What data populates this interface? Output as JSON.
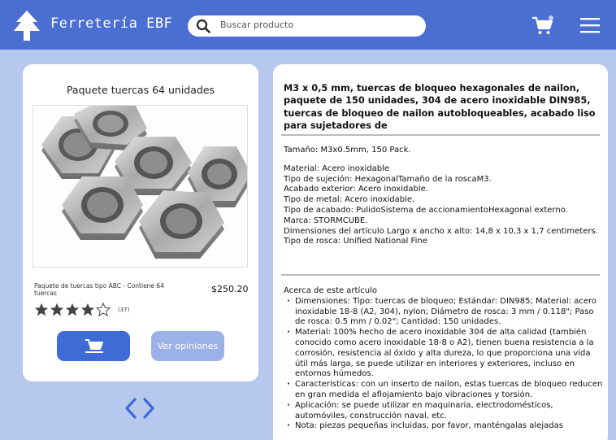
{
  "header": {
    "brand": "Ferretería EBF",
    "search_placeholder": "Buscar producto",
    "logo_icon": "pine-tree-icon",
    "cart_icon": "cart-icon",
    "menu_icon": "hamburger-menu-icon"
  },
  "product": {
    "title": "Paquete tuercas 64 unidades",
    "description": "Paquete de tuercas tipo ABC - Contiene 64 tuercas",
    "price": "$250.20",
    "rating": 4,
    "rating_max": 5,
    "reviews_count": "(37)",
    "add_to_cart_icon": "cart-icon",
    "reviews_button": "Ver opiniones"
  },
  "pager": {
    "icon": "chevron-left-right-icon"
  },
  "details": {
    "title": "M3 x 0,5 mm, tuercas de bloqueo hexagonales de nailon, paquete de 150 unidades, 304 de acero inoxidable DIN985, tuercas de bloqueo de nailon autobloqueables, acabado liso para sujetadores de",
    "size": "Tamaño: M3x0.5mm, 150 Pack.",
    "specs": [
      "Material: Acero inoxidable",
      "Tipo de sujeción: HexagonalTamaño de la roscaM3.",
      "Acabado exterior: Acero inoxidable.",
      "Tipo de metal: Acero inoxidable.",
      "Tipo de acabado: PulidoSistema de accionamientoHexagonal externo.",
      "Marca: STORMCUBE.",
      "Dimensiones del artículo Largo x ancho x alto: 14,8 x 10,3 x 1,7 centimeters.",
      "Tipo de rosca: Unified National Fine"
    ],
    "about_title": "Acerca de este artículo",
    "about_items": [
      "Dimensiones: Tipo: tuercas de bloqueo; Estándar: DIN985; Material: acero inoxidable 18-8 (A2, 304), nylon; Diámetro de rosca: 3 mm / 0.118\"; Paso de rosca: 0.5 mm / 0.02\"; Cantidad: 150 unidades.",
      "Material: 100% hecho de acero inoxidable 304 de alta calidad (también conocido como acero inoxidable 18-8 o A2), tienen buena resistencia a la corrosión, resistencia al óxido y alta dureza, lo que proporciona una vida útil más larga, se puede utilizar en interiores y exteriores, incluso en entornos húmedos.",
      "Características: con un inserto de nailon, estas tuercas de bloqueo reducen en gran medida el aflojamiento bajo vibraciones y torsión.",
      "Aplicación: se puede utilizar en maquinaria, electrodomésticos, automóviles, construcción naval, etc.",
      "Nota: piezas pequeñas incluidas, por favor, manténgalas alejadas"
    ]
  },
  "colors": {
    "header": "#4a6fd0",
    "background": "#b7c8ee",
    "primary_button": "#3f6bd6",
    "secondary_button": "#9bb1e8"
  }
}
